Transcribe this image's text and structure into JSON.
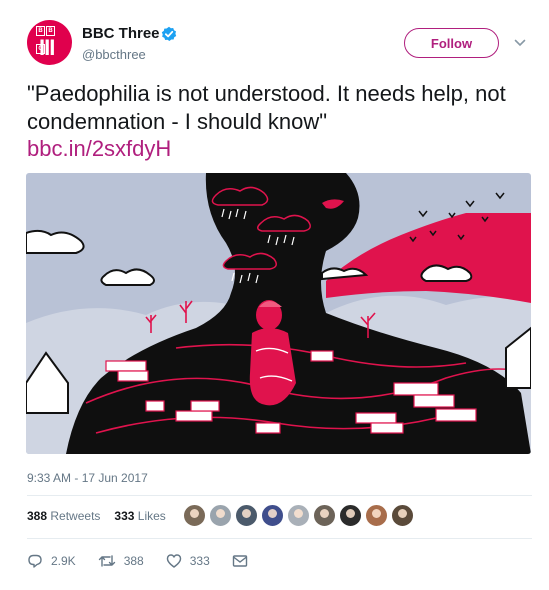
{
  "account": {
    "display_name": "BBC Three",
    "handle": "@bbcthree",
    "avatar_logo_letters": [
      "B",
      "B",
      "C"
    ],
    "avatar_mark": "III",
    "verified_icon": "verified-badge-icon"
  },
  "follow_button": {
    "label": "Follow"
  },
  "tweet": {
    "text": "\"Paedophilia is not understood. It needs help, not condemnation - I should know\"",
    "link": "bbc.in/2sxfdyH",
    "timestamp": "9:33 AM - 17 Jun 2017"
  },
  "stats": {
    "retweets_count": "388",
    "retweets_label": "Retweets",
    "likes_count": "333",
    "likes_label": "Likes"
  },
  "actions": {
    "reply_count": "2.9K",
    "retweet_count": "388",
    "like_count": "333"
  },
  "colors": {
    "brand": "#b01f7e",
    "avatar_bg": "#e0004d",
    "illustration_red": "#e0134d",
    "illustration_sky": "#b9c2d6",
    "verified_blue": "#1da1f2"
  },
  "liker_avatar_colors": [
    "#7a6a58",
    "#9aa4ad",
    "#4b5a6b",
    "#3f4e8c",
    "#a9b0b8",
    "#6c6358",
    "#2b2b2b",
    "#a86d4b",
    "#5a4a3a"
  ]
}
